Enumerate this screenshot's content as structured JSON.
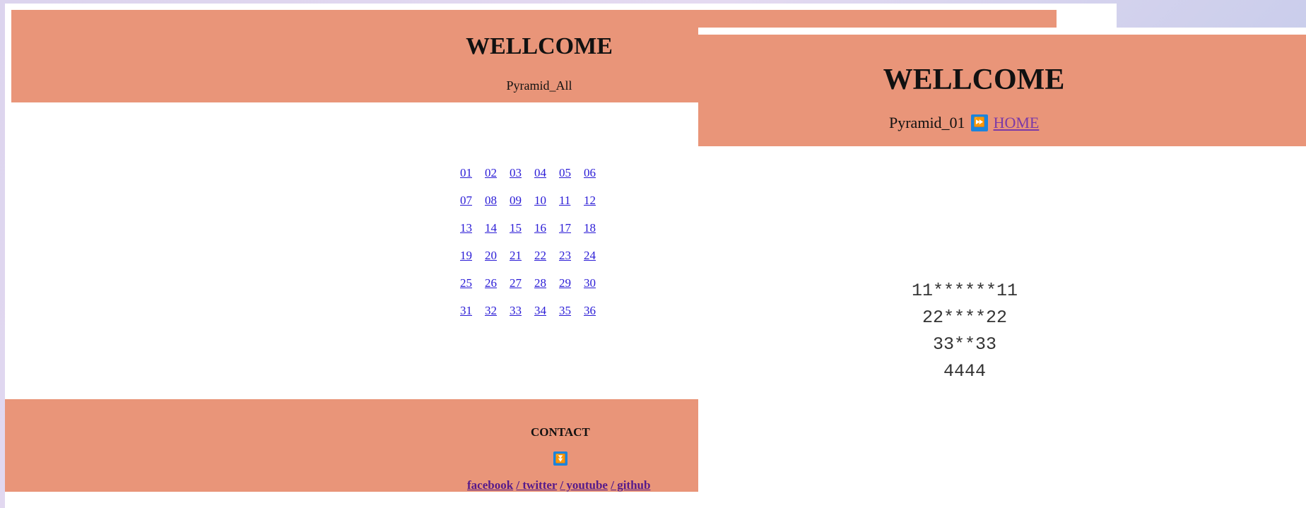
{
  "left_page": {
    "title": "WELLCOME",
    "subtitle": "Pyramid_All",
    "links": [
      "01",
      "02",
      "03",
      "04",
      "05",
      "06",
      "07",
      "08",
      "09",
      "10",
      "11",
      "12",
      "13",
      "14",
      "15",
      "16",
      "17",
      "18",
      "19",
      "20",
      "21",
      "22",
      "23",
      "24",
      "25",
      "26",
      "27",
      "28",
      "29",
      "30",
      "31",
      "32",
      "33",
      "34",
      "35",
      "36"
    ],
    "footer": {
      "contact_label": "CONTACT",
      "down_icon": "fast-down-icon",
      "facebook": "facebook",
      "twitter": "/ twitter",
      "youtube": "/ youtube",
      "github": "/ github"
    }
  },
  "right_page": {
    "title": "WELLCOME",
    "subtitle": "Pyramid_01",
    "forward_icon": "fast-forward-icon",
    "home_link": "HOME",
    "pyramid_lines": [
      "11******11",
      " 22****22",
      "  33**33",
      "   4444"
    ]
  },
  "colors": {
    "header_bg": "#e99579",
    "link": "#2a1bd6",
    "visited_link": "#551a8b",
    "icon_button": "#1b84dc"
  }
}
